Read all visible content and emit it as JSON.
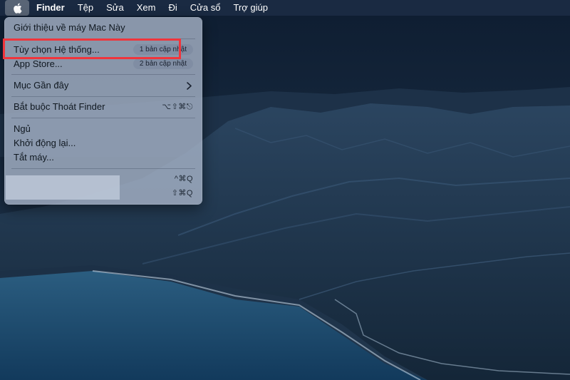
{
  "menubar": {
    "apple_icon": "apple-logo",
    "app_name": "Finder",
    "items": [
      "Tệp",
      "Sửa",
      "Xem",
      "Đi",
      "Cửa sổ",
      "Trợ giúp"
    ]
  },
  "apple_menu": {
    "about": "Giới thiệu về máy Mac Này",
    "system_prefs": {
      "label": "Tùy chọn Hệ thống...",
      "badge": "1 bản cập nhật"
    },
    "app_store": {
      "label": "App Store...",
      "badge": "2 bản cập nhật"
    },
    "recent_items": {
      "label": "Mục Gần đây",
      "icon": "chevron-right-icon"
    },
    "force_quit": {
      "label": "Bắt buộc Thoát Finder",
      "shortcut": "⌥⇧⌘⎋"
    },
    "sleep": "Ngủ",
    "restart": "Khởi động lại...",
    "shutdown": "Tắt máy...",
    "lock_screen_shortcut": "^⌘Q",
    "logout_shortcut": "⇧⌘Q"
  },
  "colors": {
    "highlight_border": "#f0353c",
    "menubar_bg": "#1c2c44",
    "menu_bg": "#a8b4c8"
  }
}
